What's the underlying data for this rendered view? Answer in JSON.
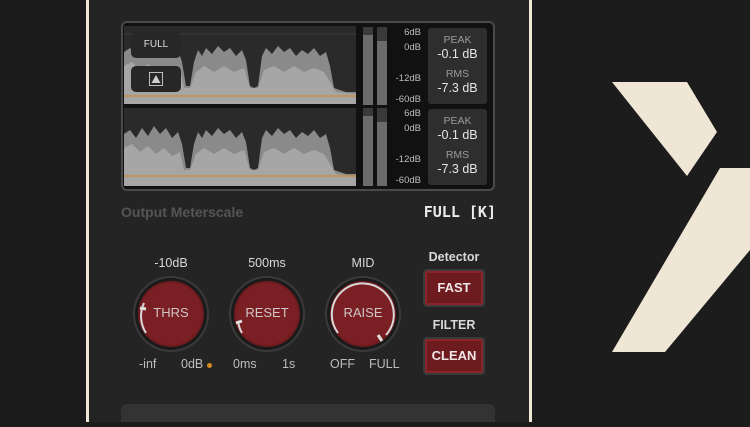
{
  "meter": {
    "view_full_label": "FULL",
    "channels": [
      {
        "scale_labels": [
          "6dB",
          "0dB",
          "-12dB",
          "-60dB"
        ],
        "peak_title": "PEAK",
        "peak_value": "-0.1 dB",
        "rms_title": "RMS",
        "rms_value": "-7.3 dB"
      },
      {
        "scale_labels": [
          "6dB",
          "0dB",
          "-12dB",
          "-60dB"
        ],
        "peak_title": "PEAK",
        "peak_value": "-0.1 dB",
        "rms_title": "RMS",
        "rms_value": "-7.3 dB"
      }
    ]
  },
  "output_meterscale": {
    "label": "Output Meterscale",
    "value": "FULL [K]"
  },
  "knobs": [
    {
      "top": "-10dB",
      "name": "THRS",
      "min": "-inf",
      "max": "0dB"
    },
    {
      "top": "500ms",
      "name": "RESET",
      "min": "0ms",
      "max": "1s"
    },
    {
      "top": "MID",
      "name": "RAISE",
      "min": "OFF",
      "max": "FULL"
    }
  ],
  "detector": {
    "label": "Detector",
    "button": "FAST"
  },
  "filter": {
    "label": "FILTER",
    "button": "CLEAN"
  },
  "colors": {
    "accent_cream": "#efe6d6",
    "knob_red": "#6e1b1f",
    "indicator_orange": "#d68a1c",
    "waveform_guide": "#c8902e"
  }
}
